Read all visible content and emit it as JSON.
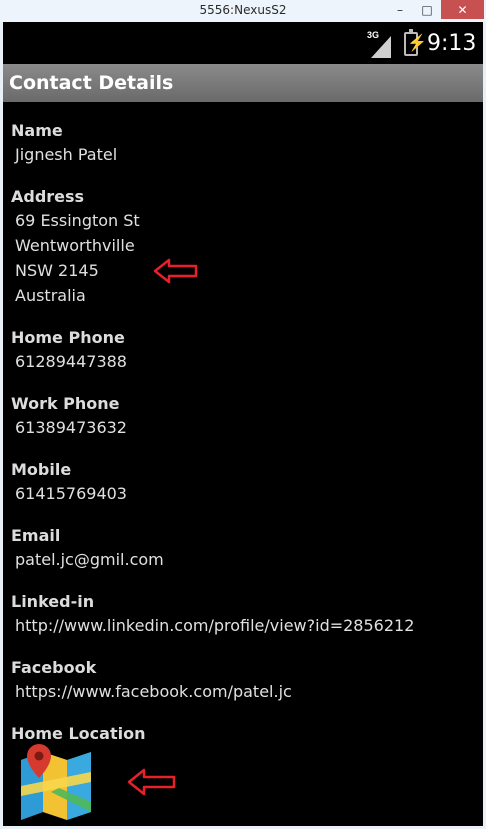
{
  "window": {
    "title": "5556:NexusS2",
    "minimize": "–",
    "maximize": "□",
    "close": "✕"
  },
  "status_bar": {
    "network": "3G",
    "time": "9:13"
  },
  "action_bar": {
    "title": "Contact Details"
  },
  "fields": [
    {
      "label": "Name",
      "lines": [
        "Jignesh Patel"
      ]
    },
    {
      "label": "Address",
      "lines": [
        "69 Essington St",
        "Wentworthville",
        "NSW 2145",
        "Australia"
      ]
    },
    {
      "label": "Home Phone",
      "lines": [
        "61289447388"
      ]
    },
    {
      "label": "Work Phone",
      "lines": [
        "61389473632"
      ]
    },
    {
      "label": "Mobile",
      "lines": [
        "61415769403"
      ]
    },
    {
      "label": "Email",
      "lines": [
        "patel.jc@gmil.com"
      ]
    },
    {
      "label": "Linked-in",
      "lines": [
        "http://www.linkedin.com/profile/view?id=2856212"
      ]
    },
    {
      "label": "Facebook",
      "lines": [
        "https://www.facebook.com/patel.jc"
      ]
    },
    {
      "label": "Home Location",
      "lines": []
    }
  ],
  "colors": {
    "annotation_arrow": "#e8202a",
    "map_pin": "#d63a2e"
  }
}
